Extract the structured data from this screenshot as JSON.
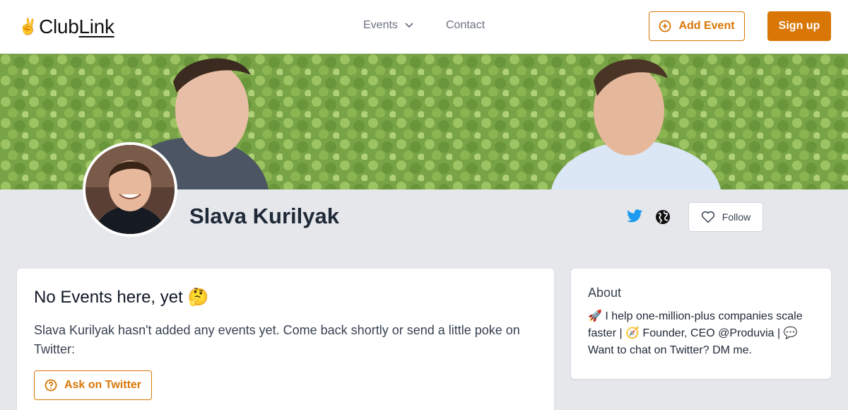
{
  "header": {
    "logo_emoji": "✌️",
    "logo_club": "Club",
    "logo_link": "Link",
    "nav_events": "Events",
    "nav_contact": "Contact",
    "add_event": "Add Event",
    "sign_up": "Sign up"
  },
  "profile": {
    "name": "Slava Kurilyak",
    "follow": "Follow"
  },
  "events": {
    "title": "No Events here, yet 🤔",
    "text": "Slava Kurilyak hasn't added any events yet. Come back shortly or send a little poke on Twitter:",
    "ask_button": "Ask on Twitter"
  },
  "about": {
    "title": "About",
    "text": "🚀 I help one-million-plus companies scale faster | 🧭 Founder, CEO @Produvia | 💬 Want to chat on Twitter? DM me."
  },
  "colors": {
    "accent": "#d97706",
    "twitter": "#1d9bf0",
    "page_bg": "#e5e7eb"
  }
}
